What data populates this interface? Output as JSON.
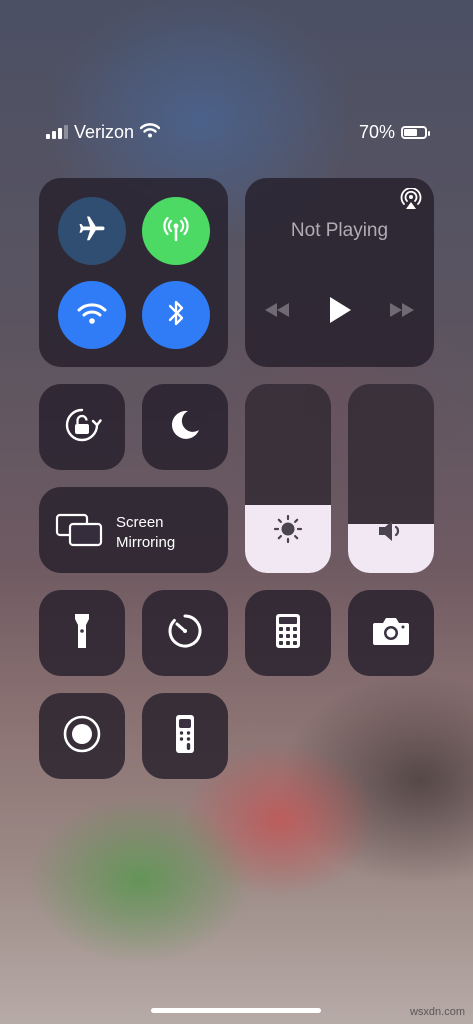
{
  "status_bar": {
    "carrier": "Verizon",
    "battery_percent": "70%",
    "battery_level": 0.7,
    "signal_bars": 3
  },
  "connectivity": {
    "airplane_mode": false,
    "cellular_data": true,
    "wifi": true,
    "bluetooth": true,
    "colors": {
      "active_green": "#4cd964",
      "active_blue": "#2f7cf6",
      "inactive": "#2f4e72"
    }
  },
  "media": {
    "title": "Not Playing"
  },
  "screen_mirroring": {
    "label_line1": "Screen",
    "label_line2": "Mirroring"
  },
  "brightness_level": 0.36,
  "volume_level": 0.26,
  "icons": [
    "airplane-icon",
    "cellular-antenna-icon",
    "wifi-icon",
    "bluetooth-icon",
    "airplay-icon",
    "rewind-icon",
    "play-icon",
    "fast-forward-icon",
    "orientation-lock-icon",
    "moon-icon",
    "screen-mirroring-icon",
    "sun-icon",
    "speaker-icon",
    "flashlight-icon",
    "timer-icon",
    "calculator-icon",
    "camera-icon",
    "screen-record-icon",
    "apple-tv-remote-icon"
  ],
  "watermark": "wsxdn.com"
}
